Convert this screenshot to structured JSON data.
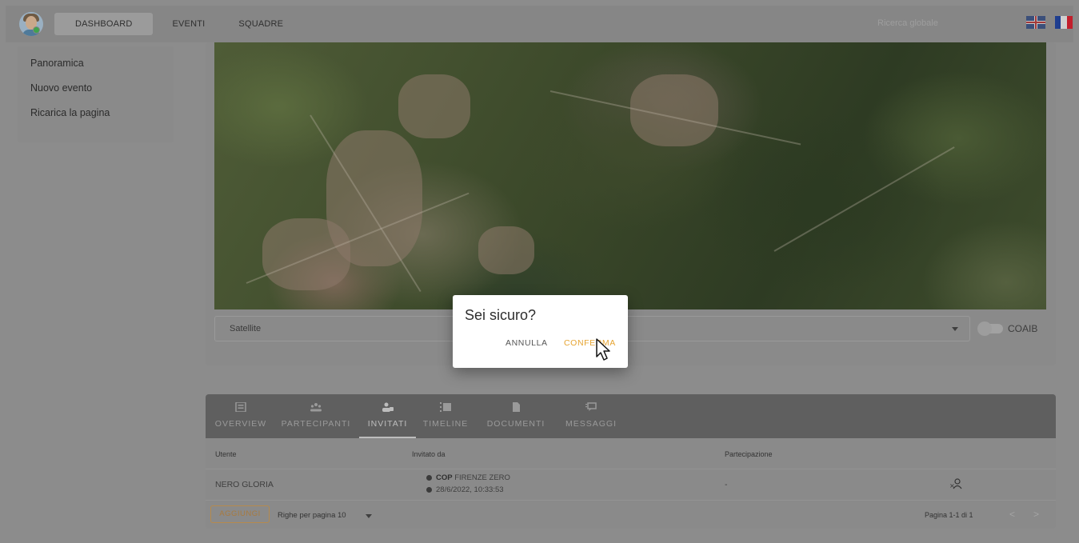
{
  "topbar": {
    "nav": {
      "dashboard": "DASHBOARD",
      "eventi": "EVENTI",
      "squadre": "SQUADRE"
    },
    "search_placeholder": "Ricerca globale",
    "languages": [
      "english-flag-icon",
      "french-flag-icon"
    ]
  },
  "sidebar": {
    "items": [
      {
        "label": "Panoramica"
      },
      {
        "label": "Nuovo evento"
      },
      {
        "label": "Ricarica la pagina"
      }
    ]
  },
  "map": {
    "layer_select": "Satellite",
    "toggle_label": "COAIB",
    "toggle_on": false
  },
  "tabs": {
    "items": [
      {
        "label": "OVERVIEW",
        "icon": "overview-icon"
      },
      {
        "label": "PARTECIPANTI",
        "icon": "group-icon"
      },
      {
        "label": "INVITATI",
        "icon": "invite-user-icon",
        "active": true
      },
      {
        "label": "TIMELINE",
        "icon": "timeline-icon"
      },
      {
        "label": "DOCUMENTI",
        "icon": "document-icon"
      },
      {
        "label": "MESSAGGI",
        "icon": "message-icon"
      }
    ]
  },
  "table": {
    "headers": {
      "utente": "Utente",
      "invitato_da": "Invitato da",
      "partecipazione": "Partecipazione"
    },
    "rows": [
      {
        "utente": "NERO GLORIA",
        "invitato_da_prefix": "COP",
        "invitato_da_name": "FIRENZE ZERO",
        "invitato_data": "28/6/2022, 10:33:53",
        "partecipazione": "-"
      }
    ]
  },
  "footer": {
    "add_label": "AGGIUNGI",
    "rows_per_page_label": "Righe per pagina",
    "rows_per_page_value": "10",
    "page_info": "Pagina 1-1 di 1",
    "prev": "<",
    "next": ">"
  },
  "dialog": {
    "title": "Sei sicuro?",
    "cancel": "ANNULLA",
    "confirm": "CONFERMA"
  },
  "colors": {
    "accent": "#e6a431",
    "overlay": "#8a8a8a",
    "tabbar": "#5f5f5f",
    "flag_fr_blue": "#1f3e8f",
    "flag_fr_white": "#cfcfcf",
    "flag_fr_red": "#c21f2c"
  }
}
